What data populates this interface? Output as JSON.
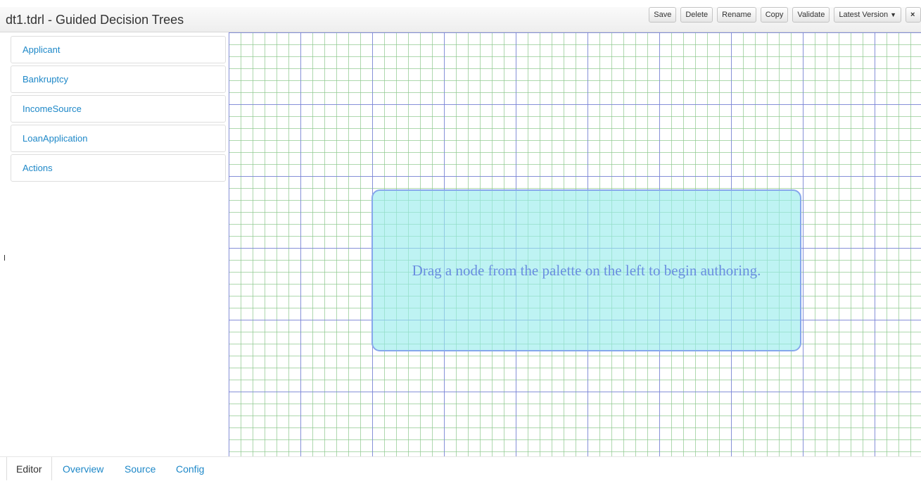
{
  "header": {
    "title": "dt1.tdrl - Guided Decision Trees"
  },
  "toolbar": {
    "save": "Save",
    "delete": "Delete",
    "rename": "Rename",
    "copy": "Copy",
    "validate": "Validate",
    "version": "Latest Version",
    "close_icon": "close-icon"
  },
  "palette": {
    "items": [
      "Applicant",
      "Bankruptcy",
      "IncomeSource",
      "LoanApplication",
      "Actions"
    ]
  },
  "canvas": {
    "hint": "Drag a node from the palette on the left to begin authoring."
  },
  "tabs": {
    "editor": "Editor",
    "overview": "Overview",
    "source": "Source",
    "config": "Config"
  },
  "colors": {
    "link": "#1e88c8",
    "grid_major": "#7878e6",
    "grid_minor": "#8cc88c",
    "hint_fill": "#96ecec",
    "hint_border": "#86a7ec",
    "hint_text": "#6a8ee0"
  }
}
